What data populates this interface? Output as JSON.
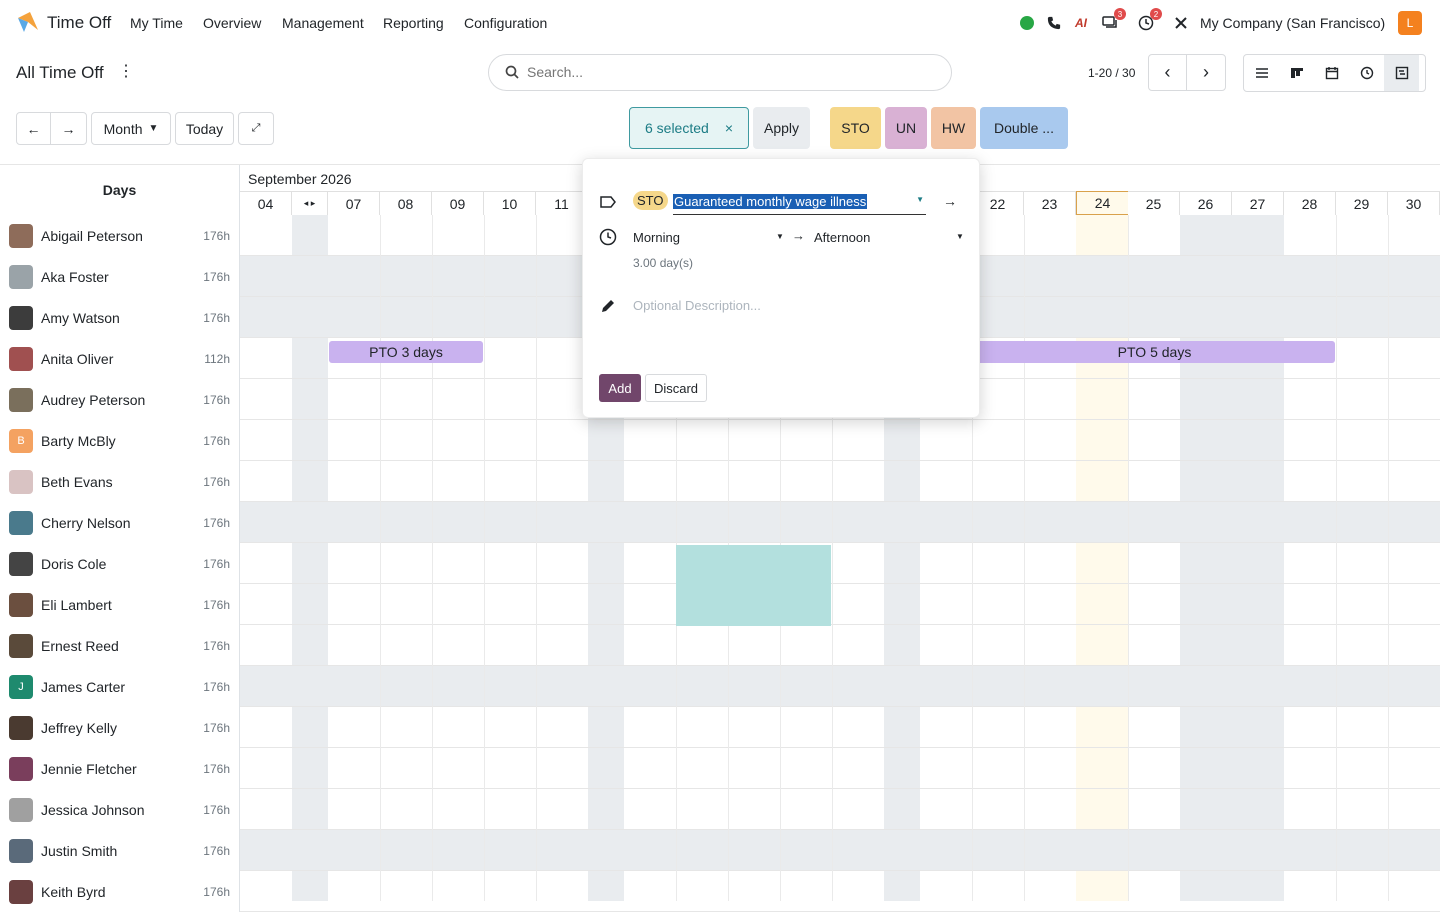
{
  "app": {
    "name": "Time Off",
    "menu": [
      "My Time",
      "Overview",
      "Management",
      "Reporting",
      "Configuration"
    ],
    "company": "My Company (San Francisco)",
    "avatar_letter": "L",
    "msg_badge": "3",
    "activity_badge": "2"
  },
  "breadcrumb": {
    "title": "All Time Off"
  },
  "search": {
    "placeholder": "Search..."
  },
  "pager": {
    "text": "1-20 / 30"
  },
  "toolbar": {
    "month": "Month",
    "today": "Today",
    "selected": "6 selected",
    "apply": "Apply"
  },
  "types": [
    {
      "label": "STO",
      "color": "#f5d78a"
    },
    {
      "label": "UN",
      "color": "#d9b1d4"
    },
    {
      "label": "HW",
      "color": "#f2c4a4"
    },
    {
      "label": "Double ...",
      "color": "#a9c9ee"
    }
  ],
  "calendar": {
    "days_header": "Days",
    "month_label": "September 2026",
    "days": [
      "04",
      "07",
      "08",
      "09",
      "10",
      "11",
      "22",
      "23",
      "24",
      "25",
      "26",
      "27",
      "28",
      "29",
      "30"
    ],
    "today": "24"
  },
  "employees": [
    {
      "name": "Abigail Peterson",
      "hours": "176h"
    },
    {
      "name": "Aka Foster",
      "hours": "176h"
    },
    {
      "name": "Amy Watson",
      "hours": "176h"
    },
    {
      "name": "Anita Oliver",
      "hours": "112h"
    },
    {
      "name": "Audrey Peterson",
      "hours": "176h"
    },
    {
      "name": "Barty McBly",
      "hours": "176h",
      "letter": "B"
    },
    {
      "name": "Beth Evans",
      "hours": "176h"
    },
    {
      "name": "Cherry Nelson",
      "hours": "176h"
    },
    {
      "name": "Doris Cole",
      "hours": "176h"
    },
    {
      "name": "Eli Lambert",
      "hours": "176h"
    },
    {
      "name": "Ernest Reed",
      "hours": "176h"
    },
    {
      "name": "James Carter",
      "hours": "176h",
      "letter": "J"
    },
    {
      "name": "Jeffrey Kelly",
      "hours": "176h"
    },
    {
      "name": "Jennie Fletcher",
      "hours": "176h"
    },
    {
      "name": "Jessica Johnson",
      "hours": "176h"
    },
    {
      "name": "Justin Smith",
      "hours": "176h"
    },
    {
      "name": "Keith Byrd",
      "hours": "176h"
    }
  ],
  "leaves": [
    {
      "label": "PTO 3 days"
    },
    {
      "label": "PTO 5 days"
    }
  ],
  "popup": {
    "type_code": "STO",
    "type_name": "Guaranteed monthly wage illness",
    "from": "Morning",
    "to": "Afternoon",
    "duration": "3.00 day(s)",
    "description_placeholder": "Optional Description...",
    "add": "Add",
    "discard": "Discard"
  }
}
